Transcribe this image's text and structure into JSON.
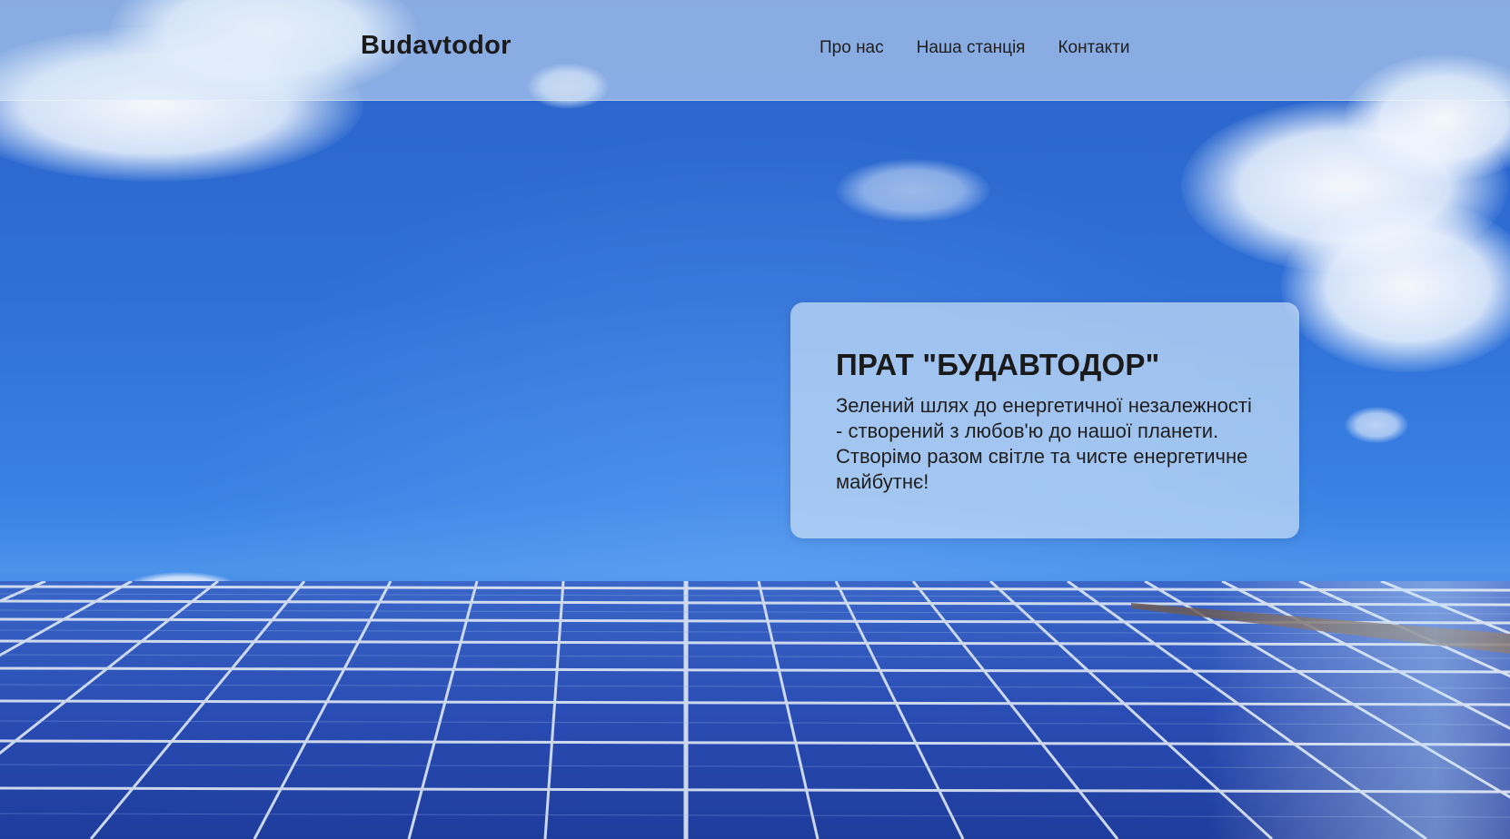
{
  "header": {
    "brand": "Budavtodor",
    "nav": [
      {
        "label": "Про нас"
      },
      {
        "label": "Наша станція"
      },
      {
        "label": "Контакти"
      }
    ]
  },
  "hero": {
    "title": "ПРАТ \"БУДАВТОДОР\"",
    "text": "Зелений шлях до енергетичної незалежності - створений з любов'ю до нашої планети. Створімо разом світле та чисте енергетичне майбутнє!"
  },
  "colors": {
    "sky": "#2f6fd6",
    "panel": "#2a4fb8",
    "header_bg": "#d7e8f8",
    "card_bg": "#c8def5",
    "text": "#1b1b1b"
  }
}
